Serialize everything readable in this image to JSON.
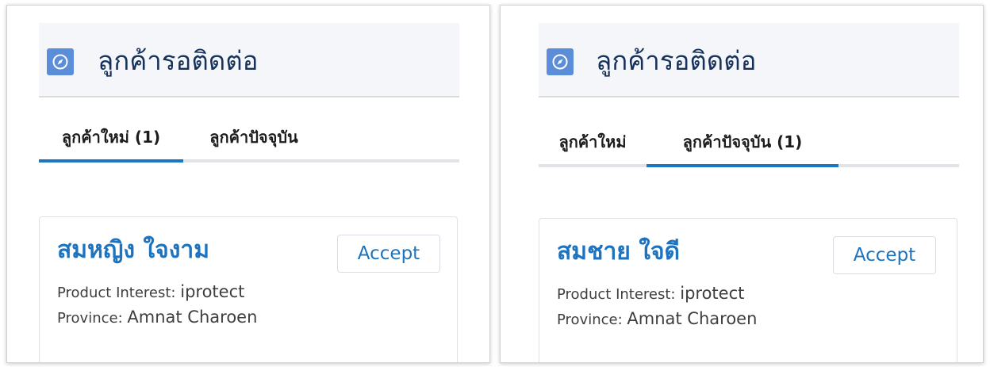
{
  "colors": {
    "icon_bg": "#5b8dd9",
    "link": "#1e73be",
    "active_tab": "#1b76c4"
  },
  "icons": {
    "app": "compass-icon"
  },
  "panels": [
    {
      "title": "ลูกค้ารอติดต่อ",
      "tabs": [
        {
          "label": "ลูกค้าใหม่ (1)",
          "active": true
        },
        {
          "label": "ลูกค้าปัจจุบัน",
          "active": false
        }
      ],
      "card": {
        "name": "สมหญิง ใจงาม",
        "accept_label": "Accept",
        "product_label": "Product Interest:",
        "product_value": "iprotect",
        "province_label": "Province:",
        "province_value": "Amnat Charoen"
      }
    },
    {
      "title": "ลูกค้ารอติดต่อ",
      "tabs": [
        {
          "label": "ลูกค้าใหม่",
          "active": false
        },
        {
          "label": "ลูกค้าปัจจุบัน (1)",
          "active": true
        }
      ],
      "card": {
        "name": "สมชาย ใจดี",
        "accept_label": "Accept",
        "product_label": "Product Interest:",
        "product_value": "iprotect",
        "province_label": "Province:",
        "province_value": "Amnat Charoen"
      }
    }
  ]
}
